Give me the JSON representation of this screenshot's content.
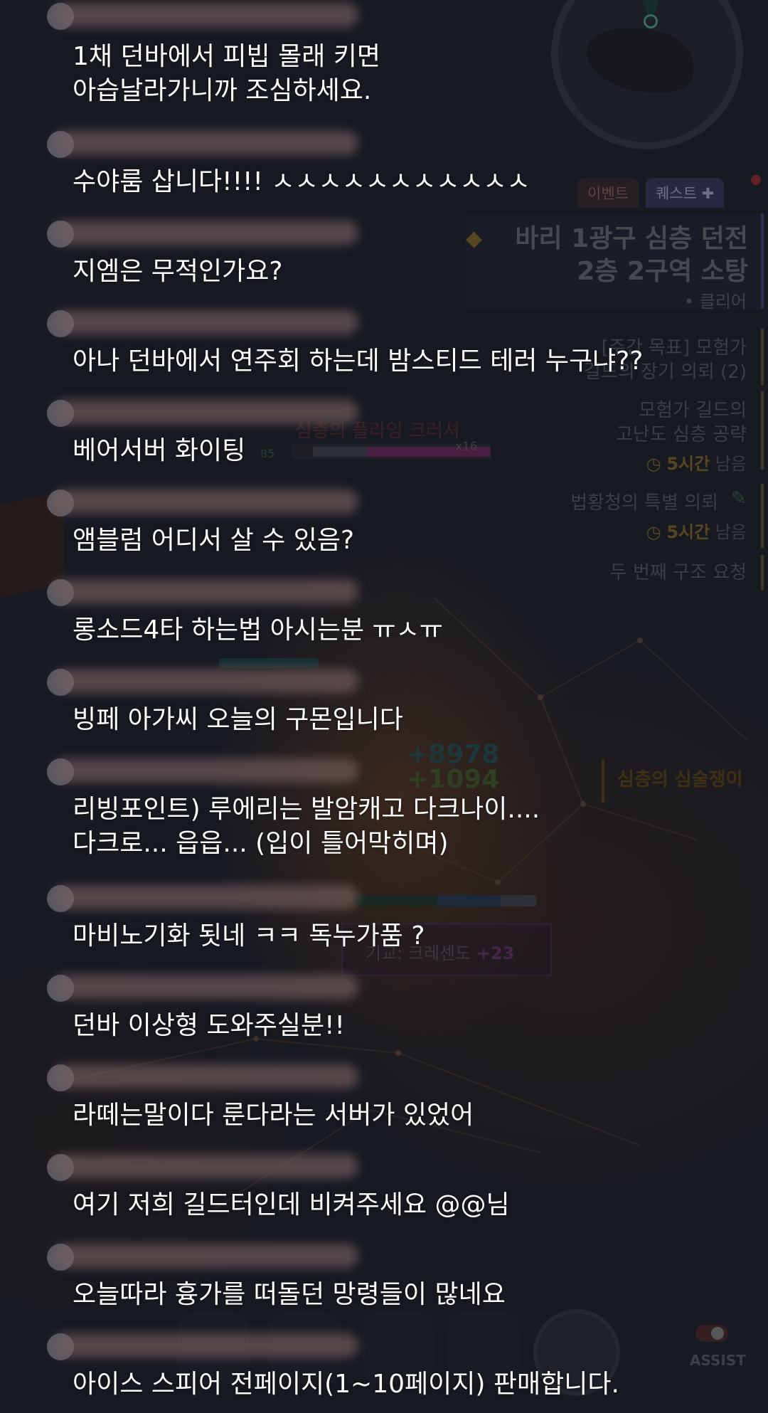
{
  "game_bg": {
    "tabs": {
      "event": "이벤트",
      "quest": "퀘스트 ✚"
    },
    "quest_title_1": "바리 1광구 심층 던전",
    "quest_title_2": "2층 2구역 소탕",
    "quest_clear": "• 클리어",
    "weekly_goal_1": "[주간 목표] 모험가",
    "weekly_goal_2": "길드의 장기 의뢰 (2)",
    "guild_quest_1": "모험가 길드의",
    "guild_quest_2": "고난도 심층 공략",
    "time_hours": "5시간",
    "time_suffix": " 남음",
    "special_request": "법황청의 특별 의뢰",
    "second_rescue": "두 번째 구조 요청",
    "boss_name": "심층의 플라잉 크러셔",
    "boss_mult": "x16",
    "boss_level": "85",
    "damage_1": "+8978",
    "damage_2": "+1094",
    "side_label": "심층의 심술쟁이",
    "target_name": "기교: 크레센도 ",
    "target_bonus": "+23",
    "assist": "ASSIST"
  },
  "chat": [
    {
      "text": "1채 던바에서 피빕 몰래 키면\n아습날라가니까 조심하세요."
    },
    {
      "text": "수야룸 삽니다!!!! ㅅㅅㅅㅅㅅㅅㅅㅅㅅㅅㅅ"
    },
    {
      "text": "지엠은 무적인가요?"
    },
    {
      "text": "아나 던바에서 연주회 하는데 밤스티드 테러 누구냐??"
    },
    {
      "text": "베어서버 화이팅"
    },
    {
      "text": "앰블럼 어디서 살 수 있음?"
    },
    {
      "text": "롱소드4타 하는법 아시는분 ㅠㅅㅠ"
    },
    {
      "text": "빙페 아가씨 오늘의 구몬입니다"
    },
    {
      "text": "리빙포인트) 루에리는 발암캐고 다크나이....\n다크로... 읍읍... (입이 틀어막히며)"
    },
    {
      "text": "마비노기화 됫네 ㅋㅋ 독누가품 ?"
    },
    {
      "text": "던바 이상형 도와주실분!!"
    },
    {
      "text": "라떼는말이다 룬다라는 서버가 있었어"
    },
    {
      "text": "여기 저희 길드터인데 비켜주세요 @@님"
    },
    {
      "text": "오늘따라 흉가를 떠돌던 망령들이 많네요"
    },
    {
      "text": "아이스 스피어 전페이지(1~10페이지) 판매합니다."
    }
  ]
}
